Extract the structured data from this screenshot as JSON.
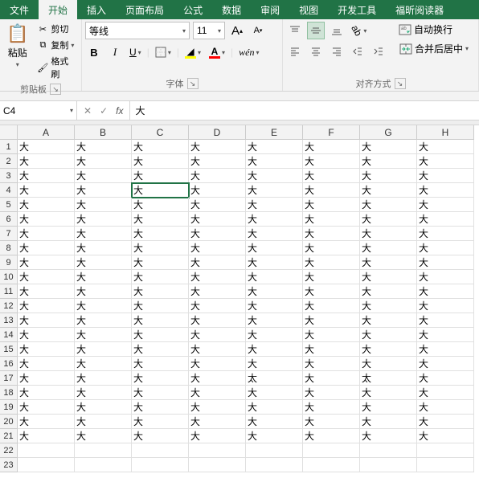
{
  "tabs": {
    "file": "文件",
    "home": "开始",
    "insert": "插入",
    "page_layout": "页面布局",
    "formulas": "公式",
    "data": "数据",
    "review": "审阅",
    "view": "视图",
    "developer": "开发工具",
    "foxit": "福昕阅读器"
  },
  "ribbon": {
    "clipboard": {
      "paste": "粘贴",
      "cut": "剪切",
      "copy": "复制",
      "format_painter": "格式刷",
      "group_label": "剪贴板"
    },
    "font": {
      "name": "等线",
      "size": "11",
      "group_label": "字体",
      "bold": "B",
      "italic": "I",
      "underline": "U",
      "wen": "wén"
    },
    "alignment": {
      "wrap_text": "自动换行",
      "merge_center": "合并后居中",
      "group_label": "对齐方式"
    }
  },
  "formula_bar": {
    "name_box": "C4",
    "fx": "fx",
    "value": "大"
  },
  "sheet": {
    "columns": [
      "A",
      "B",
      "C",
      "D",
      "E",
      "F",
      "G",
      "H"
    ],
    "selected": {
      "row": 4,
      "col": "C"
    },
    "rows": [
      {
        "n": 1,
        "c": [
          "大",
          "大",
          "大",
          "大",
          "大",
          "大",
          "大",
          "大"
        ]
      },
      {
        "n": 2,
        "c": [
          "大",
          "大",
          "大",
          "大",
          "大",
          "大",
          "大",
          "大"
        ]
      },
      {
        "n": 3,
        "c": [
          "大",
          "大",
          "大",
          "大",
          "大",
          "大",
          "大",
          "大"
        ]
      },
      {
        "n": 4,
        "c": [
          "大",
          "大",
          "大",
          "大",
          "大",
          "大",
          "大",
          "大"
        ]
      },
      {
        "n": 5,
        "c": [
          "大",
          "大",
          "大",
          "大",
          "大",
          "大",
          "大",
          "大"
        ]
      },
      {
        "n": 6,
        "c": [
          "大",
          "大",
          "大",
          "大",
          "大",
          "大",
          "大",
          "大"
        ]
      },
      {
        "n": 7,
        "c": [
          "大",
          "大",
          "大",
          "大",
          "大",
          "大",
          "大",
          "大"
        ]
      },
      {
        "n": 8,
        "c": [
          "大",
          "大",
          "大",
          "大",
          "大",
          "大",
          "大",
          "大"
        ]
      },
      {
        "n": 9,
        "c": [
          "大",
          "大",
          "大",
          "大",
          "大",
          "大",
          "大",
          "大"
        ]
      },
      {
        "n": 10,
        "c": [
          "大",
          "大",
          "大",
          "大",
          "大",
          "大",
          "大",
          "大"
        ]
      },
      {
        "n": 11,
        "c": [
          "大",
          "大",
          "大",
          "大",
          "大",
          "大",
          "大",
          "大"
        ]
      },
      {
        "n": 12,
        "c": [
          "大",
          "大",
          "大",
          "大",
          "大",
          "大",
          "大",
          "大"
        ]
      },
      {
        "n": 13,
        "c": [
          "大",
          "大",
          "大",
          "大",
          "大",
          "大",
          "大",
          "大"
        ]
      },
      {
        "n": 14,
        "c": [
          "大",
          "大",
          "大",
          "大",
          "大",
          "大",
          "大",
          "大"
        ]
      },
      {
        "n": 15,
        "c": [
          "大",
          "大",
          "大",
          "大",
          "大",
          "大",
          "大",
          "大"
        ]
      },
      {
        "n": 16,
        "c": [
          "大",
          "大",
          "大",
          "大",
          "大",
          "大",
          "大",
          "大"
        ]
      },
      {
        "n": 17,
        "c": [
          "大",
          "大",
          "大",
          "大",
          "太",
          "大",
          "太",
          "大"
        ]
      },
      {
        "n": 18,
        "c": [
          "大",
          "大",
          "大",
          "大",
          "大",
          "大",
          "大",
          "大"
        ]
      },
      {
        "n": 19,
        "c": [
          "大",
          "大",
          "大",
          "大",
          "大",
          "大",
          "大",
          "大"
        ]
      },
      {
        "n": 20,
        "c": [
          "大",
          "大",
          "大",
          "大",
          "大",
          "大",
          "大",
          "大"
        ]
      },
      {
        "n": 21,
        "c": [
          "大",
          "大",
          "大",
          "大",
          "大",
          "大",
          "大",
          "大"
        ]
      },
      {
        "n": 22,
        "c": [
          "",
          "",
          "",
          "",
          "",
          "",
          "",
          ""
        ]
      },
      {
        "n": 23,
        "c": [
          "",
          "",
          "",
          "",
          "",
          "",
          "",
          ""
        ]
      }
    ]
  }
}
